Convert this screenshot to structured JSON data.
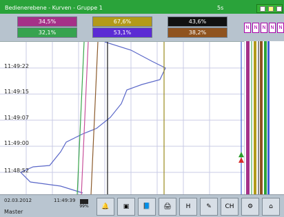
{
  "title": "Bedienerebene - Kurven - Gruppe 1",
  "sample_rate": "5s",
  "values_row1": [
    "34,5%",
    "67,6%",
    "43,6%"
  ],
  "values_row2": [
    "32,1%",
    "53,1%",
    "38,2%"
  ],
  "time_labels": [
    "11:49:22",
    "11:49:15",
    "11:49:07",
    "11:49:00",
    "11:48:52"
  ],
  "footer": {
    "date": "02.03.2012",
    "time": "11:49:39",
    "user": "Master",
    "pct": "99%"
  },
  "colors": {
    "title_bg": "#2aa33a",
    "trace_main": "#5a67c8",
    "green": "#39a64a",
    "pink": "#c84f9a",
    "olive": "#9a8a1a",
    "black": "#111111",
    "brown": "#8b5a2b",
    "blue": "#3c5fd6"
  },
  "toolbar": {
    "icons": [
      "bell-icon",
      "display-icon",
      "book-icon",
      "printer-icon",
      "h-icon",
      "pen-icon",
      "channel-icon",
      "settings-icon",
      "home-icon"
    ]
  }
}
